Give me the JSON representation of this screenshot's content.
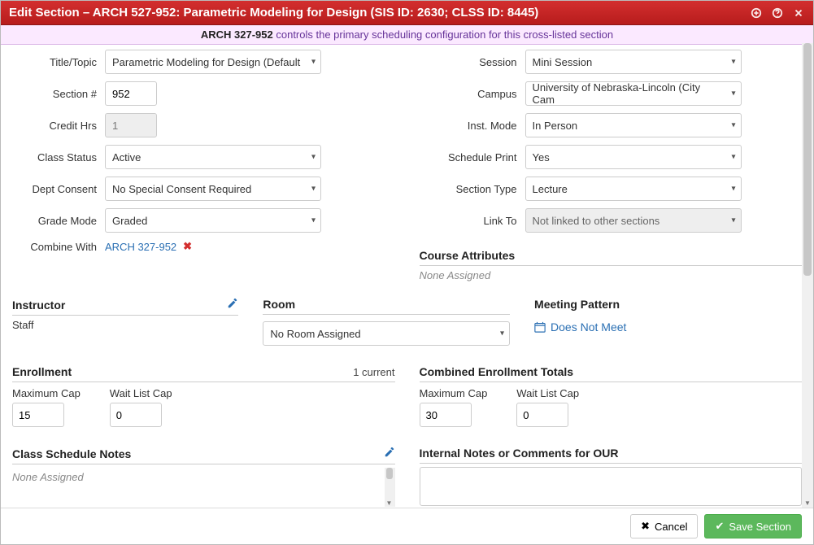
{
  "titlebar": {
    "text": "Edit Section – ARCH 527-952: Parametric Modeling for Design (SIS ID: 2630; CLSS ID: 8445)"
  },
  "notice": {
    "controller": "ARCH 327-952",
    "message": " controls the primary scheduling configuration for this cross-listed section"
  },
  "labels": {
    "title_topic": "Title/Topic",
    "section_no": "Section #",
    "credit_hrs": "Credit Hrs",
    "class_status": "Class Status",
    "dept_consent": "Dept Consent",
    "grade_mode": "Grade Mode",
    "combine_with": "Combine With",
    "session": "Session",
    "campus": "Campus",
    "inst_mode": "Inst. Mode",
    "schedule_print": "Schedule Print",
    "section_type": "Section Type",
    "link_to": "Link To",
    "course_attributes": "Course Attributes",
    "instructor": "Instructor",
    "room": "Room",
    "meeting_pattern": "Meeting Pattern",
    "enrollment": "Enrollment",
    "enrollment_aux": "1 current",
    "combined_totals": "Combined Enrollment Totals",
    "max_cap": "Maximum Cap",
    "wait_cap": "Wait List Cap",
    "class_notes": "Class Schedule Notes",
    "internal_notes": "Internal Notes or Comments for OUR"
  },
  "left": {
    "title_topic": "Parametric Modeling for Design (Default ",
    "section_no": "952",
    "credit_hrs": "1",
    "class_status": "Active",
    "dept_consent": "No Special Consent Required",
    "grade_mode": "Graded",
    "combine_link": "ARCH 327-952"
  },
  "right": {
    "session": "Mini Session",
    "campus": "University of Nebraska-Lincoln (City Cam",
    "inst_mode": "In Person",
    "schedule_print": "Yes",
    "section_type": "Lecture",
    "link_to": "Not linked to other sections"
  },
  "course_attrs": "None Assigned",
  "instructor_value": "Staff",
  "room_value": "No Room Assigned",
  "meeting_value": "Does Not Meet",
  "enrollment": {
    "max": "15",
    "wait": "0"
  },
  "combined": {
    "max": "30",
    "wait": "0"
  },
  "class_notes_value": "None Assigned",
  "internal_notes_value": "",
  "footer": {
    "cancel": "Cancel",
    "save": "Save Section"
  }
}
